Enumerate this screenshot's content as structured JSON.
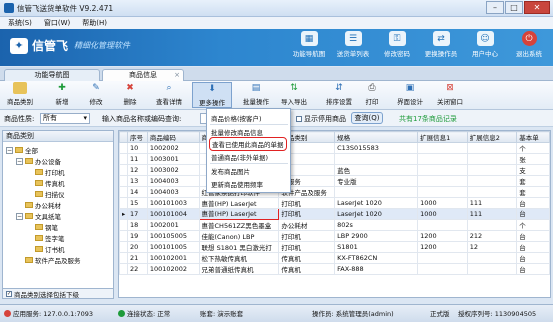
{
  "window": {
    "title": "信管飞送货单软件 V9.2.471"
  },
  "menu": [
    "系统(S)",
    "窗口(W)",
    "帮助(H)"
  ],
  "brand": {
    "name": "信管飞",
    "slogan": "精细化管理软件",
    "color": "#1b63ad"
  },
  "banner_buttons": [
    {
      "label": "功能导航图",
      "icon": "map-icon"
    },
    {
      "label": "送货单列表",
      "icon": "list-icon"
    },
    {
      "label": "修改密码",
      "icon": "key-icon"
    },
    {
      "label": "更换操作员",
      "icon": "user-switch-icon"
    },
    {
      "label": "用户中心",
      "icon": "user-icon"
    },
    {
      "label": "退出系统",
      "icon": "power-icon"
    }
  ],
  "tabs": [
    "功能导航图",
    "商品信息"
  ],
  "toolbar": [
    "商品类别",
    "新增",
    "修改",
    "删除",
    "查看详情",
    "更多操作",
    "批量操作",
    "导入导出",
    "排序设置",
    "打印",
    "界面设计",
    "关闭窗口"
  ],
  "filter": {
    "category_label": "商品性质:",
    "category_value": "所有",
    "search_hint": "输入商品名称或编码查询:",
    "show_disabled": "显示停用商品",
    "query_button": "查询(Q)",
    "count_text": "共有17条商品记录"
  },
  "sidebar": {
    "title": "商品类别",
    "tree": [
      "全部",
      "办公设备",
      "打印机",
      "传真机",
      "扫描仪",
      "办公耗材",
      "文具纸笔",
      "钢笔",
      "签字笔",
      "订书机",
      "软件产品及服务"
    ],
    "footer_checkbox": "商品类别选择包括下级"
  },
  "table": {
    "columns": [
      "序号",
      "商品编码",
      "商品名称",
      "商品类别",
      "规格",
      "扩展信息1",
      "扩展信息2",
      "基本单"
    ],
    "rows": [
      [
        "10",
        "1002002",
        "",
        "",
        "C13S015583",
        "",
        "",
        "个"
      ],
      [
        "11",
        "1003001",
        "",
        "",
        "",
        "",
        "",
        "张"
      ],
      [
        "12",
        "1003002",
        "",
        "",
        "蓝色",
        "",
        "",
        "支"
      ],
      [
        "13",
        "1004003",
        "",
        "及服务",
        "专业版",
        "",
        "",
        "套"
      ],
      [
        "14",
        "1004003",
        "红管家票据打印软件",
        "软件产品及服务",
        "",
        "",
        "",
        "套"
      ],
      [
        "15",
        "100101003",
        "惠普(HP) LaserJet",
        "打印机",
        "LaserJet 1020",
        "1000",
        "111",
        "台"
      ],
      [
        "17",
        "100101004",
        "惠普(HP) LaserJet",
        "打印机",
        "LaserJet 1020",
        "1000",
        "111",
        "台"
      ],
      [
        "18",
        "1002001",
        "惠普CH561ZZ黑色墨盒",
        "办公耗材",
        "802s",
        "",
        "",
        "个"
      ],
      [
        "19",
        "100105005",
        "佳能(Canon) LBP",
        "打印机",
        "LBP 2900",
        "1200",
        "212",
        "台"
      ],
      [
        "20",
        "100101005",
        "联想 S1801 黑白激光打",
        "打印机",
        "S1801",
        "1200",
        "12",
        "台"
      ],
      [
        "21",
        "100102001",
        "松下热敏传真机",
        "传真机",
        "KX-FT862CN",
        "",
        "",
        "台"
      ],
      [
        "22",
        "100102002",
        "兄弟普通纸传真机",
        "传真机",
        "FAX-888",
        "",
        "",
        "台"
      ]
    ]
  },
  "more_menu": [
    "商品价格(按客户)",
    "批量修改商品信息",
    "查看已使用此商品的单据",
    "普通商品(非外单据)",
    "发布商品图片",
    "更新商品使用频率"
  ],
  "status": {
    "app_server": "应用服务: 127.0.0.1:7093",
    "connection": "连接状态: 正常",
    "account": "账套: 演示账套",
    "operator": "操作员: 系统管理员(admin)",
    "edition": "正式版",
    "license": "授权序列号: 1130904505"
  }
}
